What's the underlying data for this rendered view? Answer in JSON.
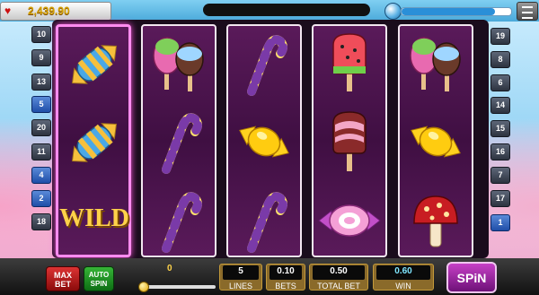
{
  "header": {
    "balance": "2,439.90",
    "balance_icon": "heart-coin-icon",
    "xp_progress": 0.85,
    "menu_icon": "hamburger-menu-icon"
  },
  "reels": [
    [
      "blue-wrapped-candy",
      "blue-wrapped-candy",
      "wild"
    ],
    [
      "popsicle-pair",
      "candy-cane",
      "candy-cane"
    ],
    [
      "candy-cane",
      "yellow-wrapped-candy",
      "candy-cane"
    ],
    [
      "watermelon-popsicle",
      "chocolate-popsicle",
      "pink-swirl-candy"
    ],
    [
      "popsicle-pair",
      "yellow-wrapped-candy",
      "red-mushroom"
    ]
  ],
  "symbols": {
    "wild_label": "WILD"
  },
  "left_lines": [
    "10",
    "9",
    "13",
    "5",
    "20",
    "11",
    "4",
    "2",
    "18"
  ],
  "right_lines": [
    "19",
    "8",
    "6",
    "14",
    "15",
    "16",
    "7",
    "17",
    "1"
  ],
  "lit_lines": [
    "5",
    "4",
    "2",
    "1"
  ],
  "controls": {
    "max_bet_line1": "MAX",
    "max_bet_line2": "BET",
    "auto_spin_line1": "AUTO",
    "auto_spin_line2": "SPIN",
    "slider_value": "0",
    "lines_value": "5",
    "lines_label": "LINES",
    "bets_value": "0.10",
    "bets_label": "BETS",
    "total_bet_value": "0.50",
    "total_bet_label": "TOTAL BET",
    "win_value": "0.60",
    "win_label": "WIN",
    "spin_label": "SPiN"
  },
  "colors": {
    "reel_bg": "#4a124c",
    "reel_highlight": "#ff8cf0",
    "spin_button": "#a22aa8",
    "win_value": "#7fe6ff"
  }
}
